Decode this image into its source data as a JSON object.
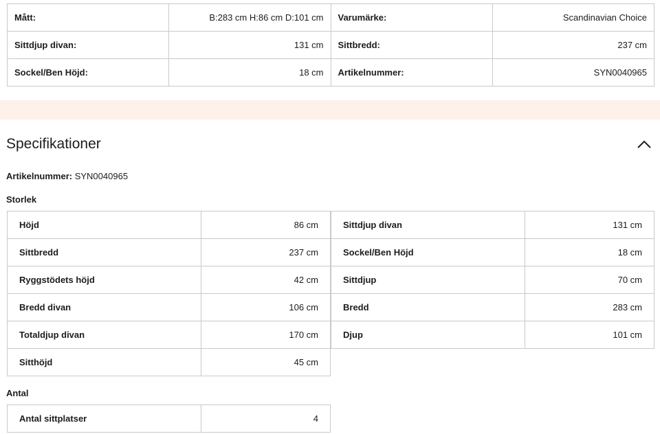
{
  "top_table": {
    "rows": [
      {
        "left_label": "Mått:",
        "left_value": "B:283 cm H:86 cm D:101 cm",
        "right_label": "Varumärke:",
        "right_value": "Scandinavian Choice"
      },
      {
        "left_label": "Sittdjup divan:",
        "left_value": "131 cm",
        "right_label": "Sittbredd:",
        "right_value": "237 cm"
      },
      {
        "left_label": "Sockel/Ben Höjd:",
        "left_value": "18 cm",
        "right_label": "Artikelnummer:",
        "right_value": "SYN0040965"
      }
    ]
  },
  "specs": {
    "title": "Specifikationer",
    "toggle_icon": "chevron-up-icon",
    "article_label": "Artikelnummer:",
    "article_value": "SYN0040965",
    "storlek": {
      "label": "Storlek",
      "left": [
        {
          "label": "Höjd",
          "value": "86 cm"
        },
        {
          "label": "Sittbredd",
          "value": "237 cm"
        },
        {
          "label": "Ryggstödets höjd",
          "value": "42 cm"
        },
        {
          "label": "Bredd divan",
          "value": "106 cm"
        },
        {
          "label": "Totaldjup divan",
          "value": "170 cm"
        },
        {
          "label": "Sitthöjd",
          "value": "45 cm"
        }
      ],
      "right": [
        {
          "label": "Sittdjup divan",
          "value": "131 cm"
        },
        {
          "label": "Sockel/Ben Höjd",
          "value": "18 cm"
        },
        {
          "label": "Sittdjup",
          "value": "70 cm"
        },
        {
          "label": "Bredd",
          "value": "283 cm"
        },
        {
          "label": "Djup",
          "value": "101 cm"
        }
      ]
    },
    "antal": {
      "label": "Antal",
      "rows": [
        {
          "label": "Antal sittplatser",
          "value": "4"
        }
      ]
    }
  },
  "colors": {
    "band": "#fdf1e9",
    "border": "#c9c9c9",
    "text": "#1c1c1c"
  }
}
